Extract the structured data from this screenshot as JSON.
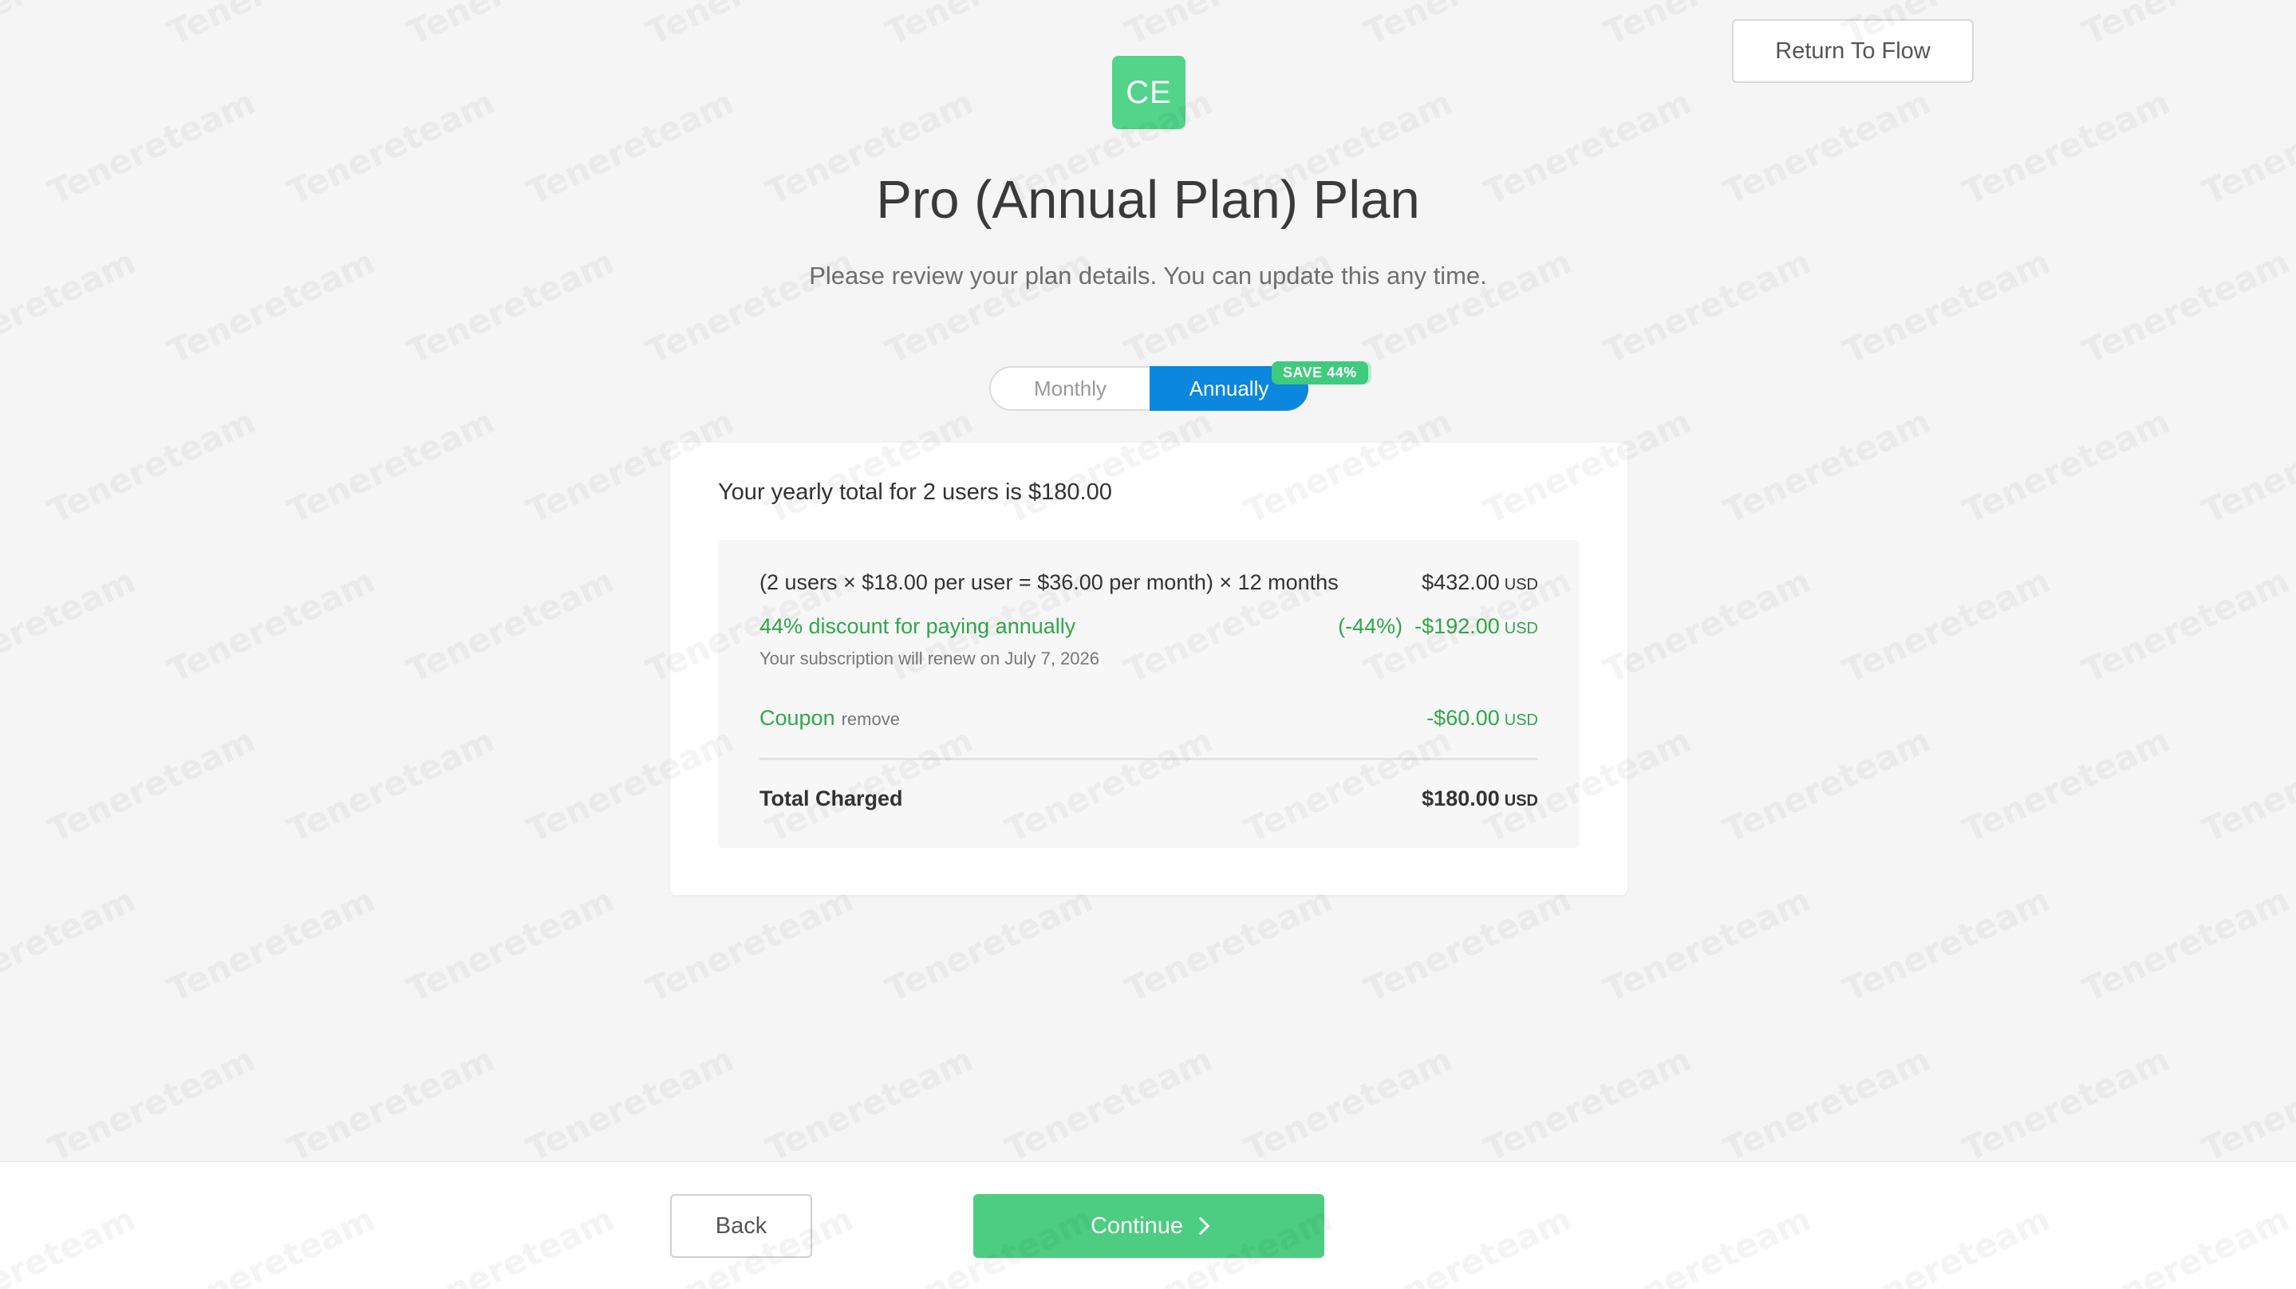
{
  "header": {
    "logo_text": "CE",
    "logo_color": "#52d48a",
    "return_label": "Return To Flow",
    "title": "Pro (Annual Plan) Plan",
    "subtitle": "Please review your plan details. You can update this any time."
  },
  "billing_toggle": {
    "options": [
      "Monthly",
      "Annually"
    ],
    "selected": "Annually",
    "badge": "SAVE 44%",
    "active_color": "#0b87de"
  },
  "summary": {
    "heading": "Your yearly total for 2 users is $180.00",
    "base": {
      "label": "(2 users × $18.00 per user = $36.00 per month) × 12 months",
      "amount": "$432.00",
      "currency": "USD"
    },
    "discount": {
      "label": "44% discount for paying annually",
      "amount": "(-44%)  -$192.00",
      "currency": "USD",
      "color": "#2ea84a"
    },
    "renewal": "Your subscription will renew on July 7, 2026",
    "coupon": {
      "label": "Coupon",
      "remove_label": "remove",
      "amount": "-$60.00",
      "currency": "USD"
    },
    "total": {
      "label": "Total Charged",
      "amount": "$180.00",
      "currency": "USD"
    }
  },
  "footer": {
    "back_label": "Back",
    "continue_label": "Continue",
    "continue_color": "#4ccd82"
  },
  "watermark": {
    "text": "Tenereteam"
  }
}
